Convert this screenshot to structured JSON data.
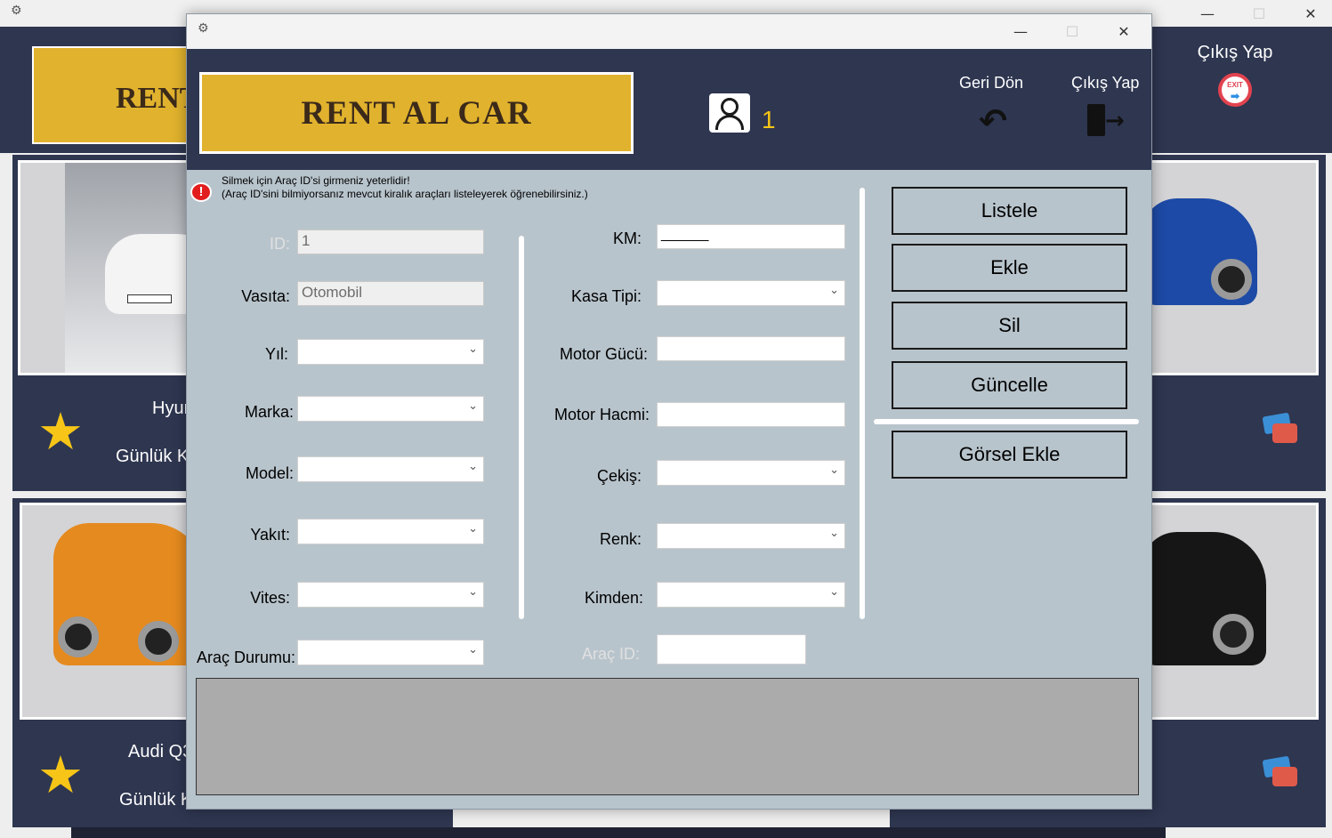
{
  "background_window": {
    "logo_text": "RENT AL CAR",
    "exit_label": "Çıkış Yap",
    "exit_badge_text": "EXIT",
    "cards": [
      {
        "name": "Hyundai",
        "price_label": "Günlük Kira"
      },
      {
        "name": "Audi Q3",
        "price_label": "Günlük Kira"
      }
    ]
  },
  "dialog": {
    "logo_text": "RENT AL CAR",
    "user_id": "1",
    "back_label": "Geri Dön",
    "exit_label": "Çıkış Yap",
    "warning_line1": "Silmek için Araç ID'si girmeniz yeterlidir!",
    "warning_line2": "(Araç ID'sini bilmiyorsanız mevcut kiralık araçları listeleyerek öğrenebilirsiniz.)",
    "labels": {
      "id": "ID:",
      "vasita": "Vasıta:",
      "yil": "Yıl:",
      "marka": "Marka:",
      "model": "Model:",
      "yakit": "Yakıt:",
      "vites": "Vites:",
      "arac_durumu": "Araç Durumu:",
      "km": "KM:",
      "kasa_tipi": "Kasa Tipi:",
      "motor_gucu": "Motor Gücü:",
      "motor_hacmi": "Motor Hacmi:",
      "cekis": "Çekiş:",
      "renk": "Renk:",
      "kimden": "Kimden:",
      "arac_id": "Araç ID:"
    },
    "values": {
      "id": "1",
      "vasita": "Otomobil",
      "km": "______",
      "motor_gucu": "",
      "motor_hacmi": "",
      "arac_id": ""
    },
    "buttons": {
      "listele": "Listele",
      "ekle": "Ekle",
      "sil": "Sil",
      "guncelle": "Güncelle",
      "gorsel_ekle": "Görsel Ekle"
    }
  },
  "colors": {
    "header_navy": "#2e3650",
    "logo_gold": "#e1b22d",
    "form_bg": "#b8c4cc",
    "accent_yellow": "#f6c517"
  }
}
